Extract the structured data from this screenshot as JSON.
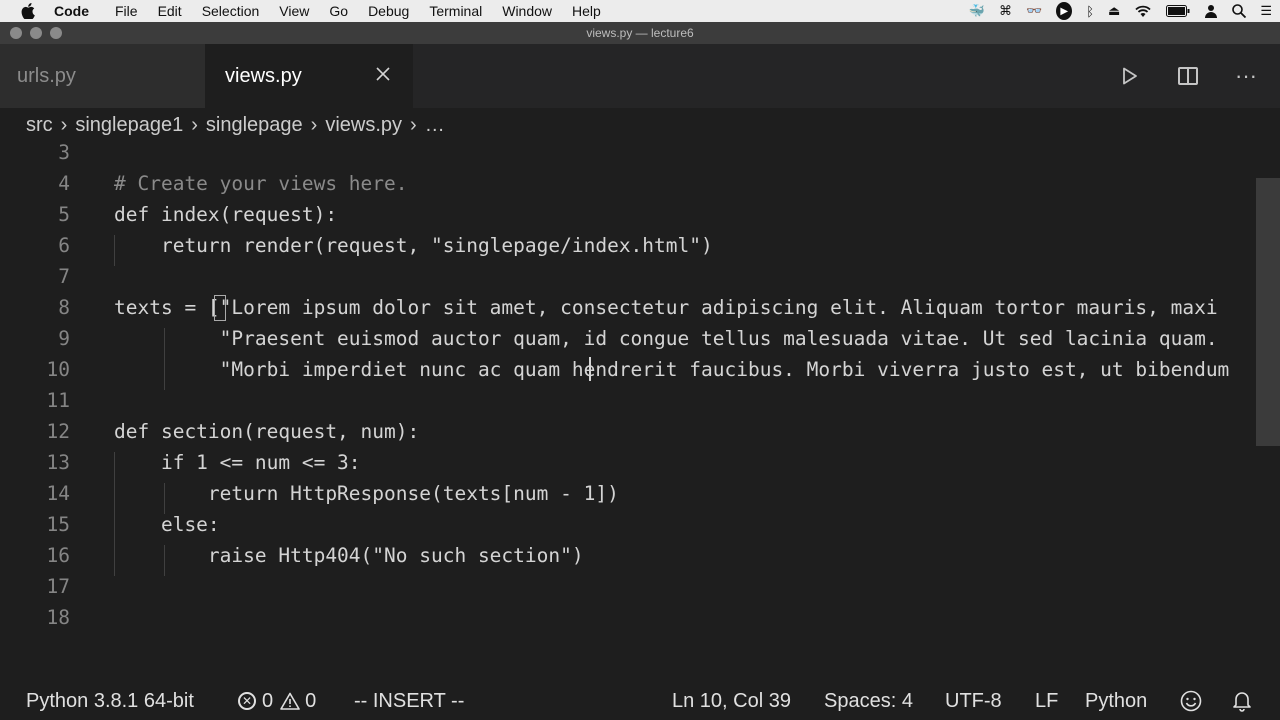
{
  "menubar": {
    "app_name": "Code",
    "items": [
      "File",
      "Edit",
      "Selection",
      "View",
      "Go",
      "Debug",
      "Terminal",
      "Window",
      "Help"
    ]
  },
  "window": {
    "title": "views.py — lecture6"
  },
  "tabs": [
    {
      "label": "urls.py",
      "active": false
    },
    {
      "label": "views.py",
      "active": true
    }
  ],
  "breadcrumb": [
    "src",
    "singlepage1",
    "singlepage",
    "views.py",
    "…"
  ],
  "editor": {
    "lines": [
      {
        "num": "3",
        "text": ""
      },
      {
        "num": "4",
        "text": "# Create your views here."
      },
      {
        "num": "5",
        "text": "def index(request):"
      },
      {
        "num": "6",
        "text": "    return render(request, \"singlepage/index.html\")"
      },
      {
        "num": "7",
        "text": ""
      },
      {
        "num": "8",
        "text": "texts = [\"Lorem ipsum dolor sit amet, consectetur adipiscing elit. Aliquam tortor mauris, maxi"
      },
      {
        "num": "9",
        "text": "         \"Praesent euismod auctor quam, id congue tellus malesuada vitae. Ut sed lacinia quam."
      },
      {
        "num": "10",
        "text": "         \"Morbi imperdiet nunc ac quam hendrerit faucibus. Morbi viverra justo est, ut bibendum"
      },
      {
        "num": "11",
        "text": ""
      },
      {
        "num": "12",
        "text": "def section(request, num):"
      },
      {
        "num": "13",
        "text": "    if 1 <= num <= 3:"
      },
      {
        "num": "14",
        "text": "        return HttpResponse(texts[num - 1])"
      },
      {
        "num": "15",
        "text": "    else:"
      },
      {
        "num": "16",
        "text": "        raise Http404(\"No such section\")"
      },
      {
        "num": "17",
        "text": ""
      },
      {
        "num": "18",
        "text": ""
      }
    ]
  },
  "statusbar": {
    "interpreter": "Python 3.8.1 64-bit",
    "errors": "0",
    "warnings": "0",
    "mode": "-- INSERT --",
    "position": "Ln 10, Col 39",
    "spaces": "Spaces: 4",
    "encoding": "UTF-8",
    "eol": "LF",
    "language": "Python"
  },
  "icons": {
    "apple": "apple-logo-icon",
    "close": "close-icon",
    "run": "play-icon",
    "split": "split-editor-icon",
    "more": "ellipsis-icon",
    "error": "error-circle-icon",
    "warning": "warning-triangle-icon",
    "feedback": "smiley-icon",
    "bell": "bell-icon"
  }
}
